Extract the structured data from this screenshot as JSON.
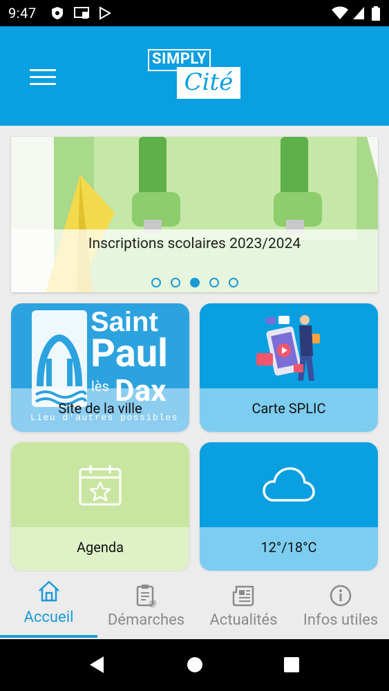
{
  "status_bar": {
    "time": "9:47",
    "left_icons": [
      "shield-icon",
      "cast-icon",
      "play-store-icon"
    ],
    "right_icons": [
      "wifi-icon",
      "signal-icon",
      "battery-icon"
    ]
  },
  "header": {
    "background_color": "#0a9fe0",
    "logo_simply": "SIMPLY",
    "logo_cite": "Cité"
  },
  "carousel": {
    "caption": "Inscriptions scolaires 2023/2024",
    "slide_count": 5,
    "active_index": 2
  },
  "tiles": [
    {
      "label": "Site de la ville",
      "logo_text_1": "Saint",
      "logo_text_2": "Paul",
      "logo_text_3": "lès",
      "logo_text_4": "Dax",
      "logo_tagline": "Lieu d'autres possibles"
    },
    {
      "label": "Carte SPLIC"
    },
    {
      "label": "Agenda"
    },
    {
      "label": "12°/18°C"
    }
  ],
  "bottom_nav": {
    "items": [
      {
        "label": "Accueil",
        "icon": "home-icon",
        "active": true
      },
      {
        "label": "Démarches",
        "icon": "clipboard-icon",
        "active": false
      },
      {
        "label": "Actualités",
        "icon": "newspaper-icon",
        "active": false
      },
      {
        "label": "Infos utiles",
        "icon": "info-icon",
        "active": false
      }
    ]
  },
  "colors": {
    "accent": "#1b9ad6",
    "tile_blue": "#0a9fe0",
    "tile_green": "#c9e6a0"
  }
}
